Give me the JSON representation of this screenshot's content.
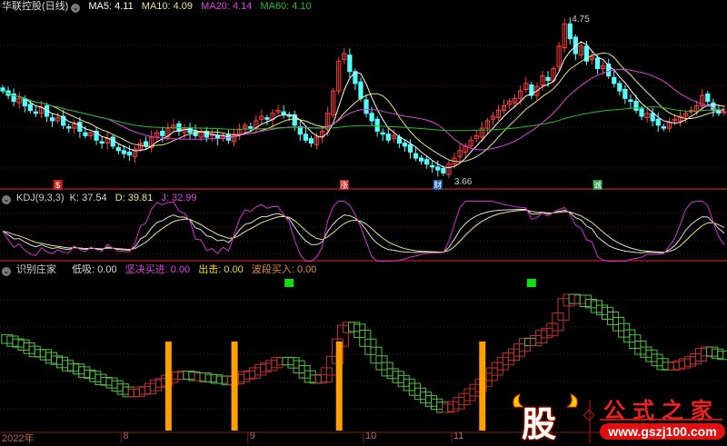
{
  "main": {
    "title": "华联控股(日线)",
    "ma5": "MA5: 4.11",
    "ma10": "MA10: 4.09",
    "ma20": "MA20: 4.14",
    "ma60": "MA60: 4.10",
    "high_label": "4.75",
    "low_label": "3.66",
    "markers": [
      {
        "text": "$",
        "bar": 10,
        "color": "#d02020"
      },
      {
        "text": "涨",
        "bar": 62,
        "color": "#c02020"
      },
      {
        "text": "财",
        "bar": 79,
        "color": "#2060b0"
      },
      {
        "text": "诚",
        "bar": 108,
        "color": "#20a040"
      }
    ]
  },
  "kdj": {
    "title": "KDJ(9,3,3)",
    "k": "K: 37.54",
    "d": "D: 39.81",
    "j": "J: 32.99"
  },
  "indicator": {
    "title": "识别庄家",
    "low_buy": "低吸: 0.00",
    "firm_buy": "坚决买进: 0.00",
    "exit": "出击: 0.00",
    "wave_buy": "波段买入: 0.00",
    "orange_bars": [
      30,
      42,
      61,
      87
    ],
    "green_squares": [
      52,
      96
    ]
  },
  "axis": {
    "ticks": [
      {
        "label": "2022年",
        "bar": 0
      },
      {
        "label": "8",
        "bar": 22
      },
      {
        "label": "9",
        "bar": 45
      },
      {
        "label": "10",
        "bar": 66
      },
      {
        "label": "11",
        "bar": 82
      }
    ]
  },
  "watermark": {
    "icon_text": "股",
    "name": "公式之家",
    "url": "www.gszj100.com"
  },
  "colors": {
    "up": "#ff3c3c",
    "down": "#54ffff",
    "ma5": "#ffffff",
    "ma10": "#e8e880",
    "ma20": "#e040e0",
    "ma60": "#20c020",
    "orange": "#ffa000"
  },
  "chart_data": {
    "type": "candlestick",
    "closes": [
      4.25,
      4.22,
      4.18,
      4.2,
      4.15,
      4.12,
      4.1,
      4.14,
      4.08,
      4.05,
      4.07,
      4.02,
      4.0,
      4.03,
      3.98,
      3.95,
      3.97,
      3.92,
      3.9,
      3.93,
      3.88,
      3.85,
      3.83,
      3.82,
      3.86,
      3.9,
      3.88,
      3.94,
      3.97,
      3.95,
      4.0,
      4.02,
      3.98,
      4.0,
      3.97,
      3.95,
      3.98,
      3.94,
      3.96,
      3.93,
      3.95,
      3.92,
      3.96,
      3.99,
      4.02,
      4.0,
      4.05,
      4.08,
      4.06,
      4.1,
      4.12,
      4.09,
      4.08,
      4.02,
      3.96,
      3.92,
      3.9,
      3.94,
      3.98,
      4.1,
      4.25,
      4.45,
      4.5,
      4.38,
      4.3,
      4.2,
      4.1,
      4.05,
      3.98,
      3.96,
      3.92,
      3.95,
      3.9,
      3.88,
      3.84,
      3.8,
      3.78,
      3.76,
      3.74,
      3.72,
      3.7,
      3.76,
      3.8,
      3.85,
      3.88,
      3.92,
      3.95,
      4.0,
      4.05,
      4.08,
      4.12,
      4.15,
      4.18,
      4.2,
      4.25,
      4.3,
      4.22,
      4.28,
      4.35,
      4.32,
      4.4,
      4.55,
      4.7,
      4.6,
      4.5,
      4.55,
      4.45,
      4.48,
      4.4,
      4.42,
      4.35,
      4.3,
      4.25,
      4.2,
      4.18,
      4.12,
      4.08,
      4.1,
      4.05,
      4.02,
      4.0,
      4.04,
      4.06,
      4.08,
      4.1,
      4.12,
      4.15,
      4.22,
      4.18,
      4.12,
      4.1,
      4.11
    ],
    "ylim": [
      3.66,
      4.75
    ]
  }
}
